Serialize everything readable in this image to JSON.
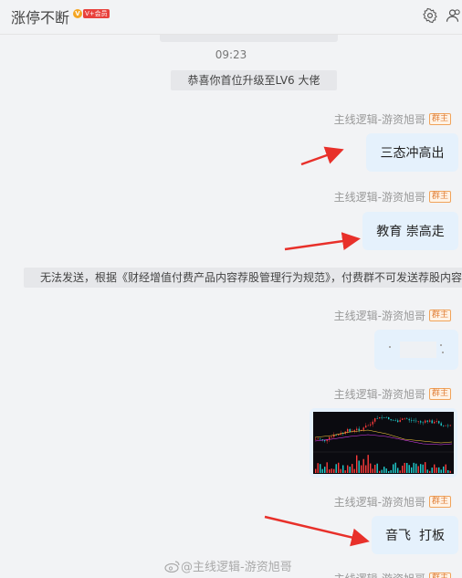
{
  "header": {
    "title": "涨停不断",
    "vip_badge": "V",
    "vip_label": "V+会员",
    "settings_icon": "gear-icon",
    "members_icon": "members-icon"
  },
  "chat": {
    "timestamp": "09:23",
    "system_message": "恭喜你首位升级至LV6 大佬",
    "notice": "无法发送，根据《财经增值付费产品内容荐股管理行为规范》，付费群不可发送荐股内容",
    "messages": [
      {
        "sender": "主线逻辑-游资旭哥",
        "badge": "群主",
        "text": "三态冲高出"
      },
      {
        "sender": "主线逻辑-游资旭哥",
        "badge": "群主",
        "text": "教育 崇高走"
      },
      {
        "sender": "主线逻辑-游资旭哥",
        "badge": "群主",
        "text": ""
      },
      {
        "sender": "主线逻辑-游资旭哥",
        "badge": "群主",
        "text": ""
      },
      {
        "sender": "主线逻辑-游资旭哥",
        "badge": "群主",
        "text": "音飞  打板"
      },
      {
        "sender": "主线逻辑-游资旭哥",
        "badge": "群主",
        "text": ""
      }
    ]
  },
  "watermark": {
    "text": "@主线逻辑-游资旭哥",
    "icon": "weibo-icon"
  },
  "colors": {
    "bubble": "#e5f1fc",
    "arrow": "#e8302a",
    "badge_border": "#f0a35a"
  }
}
